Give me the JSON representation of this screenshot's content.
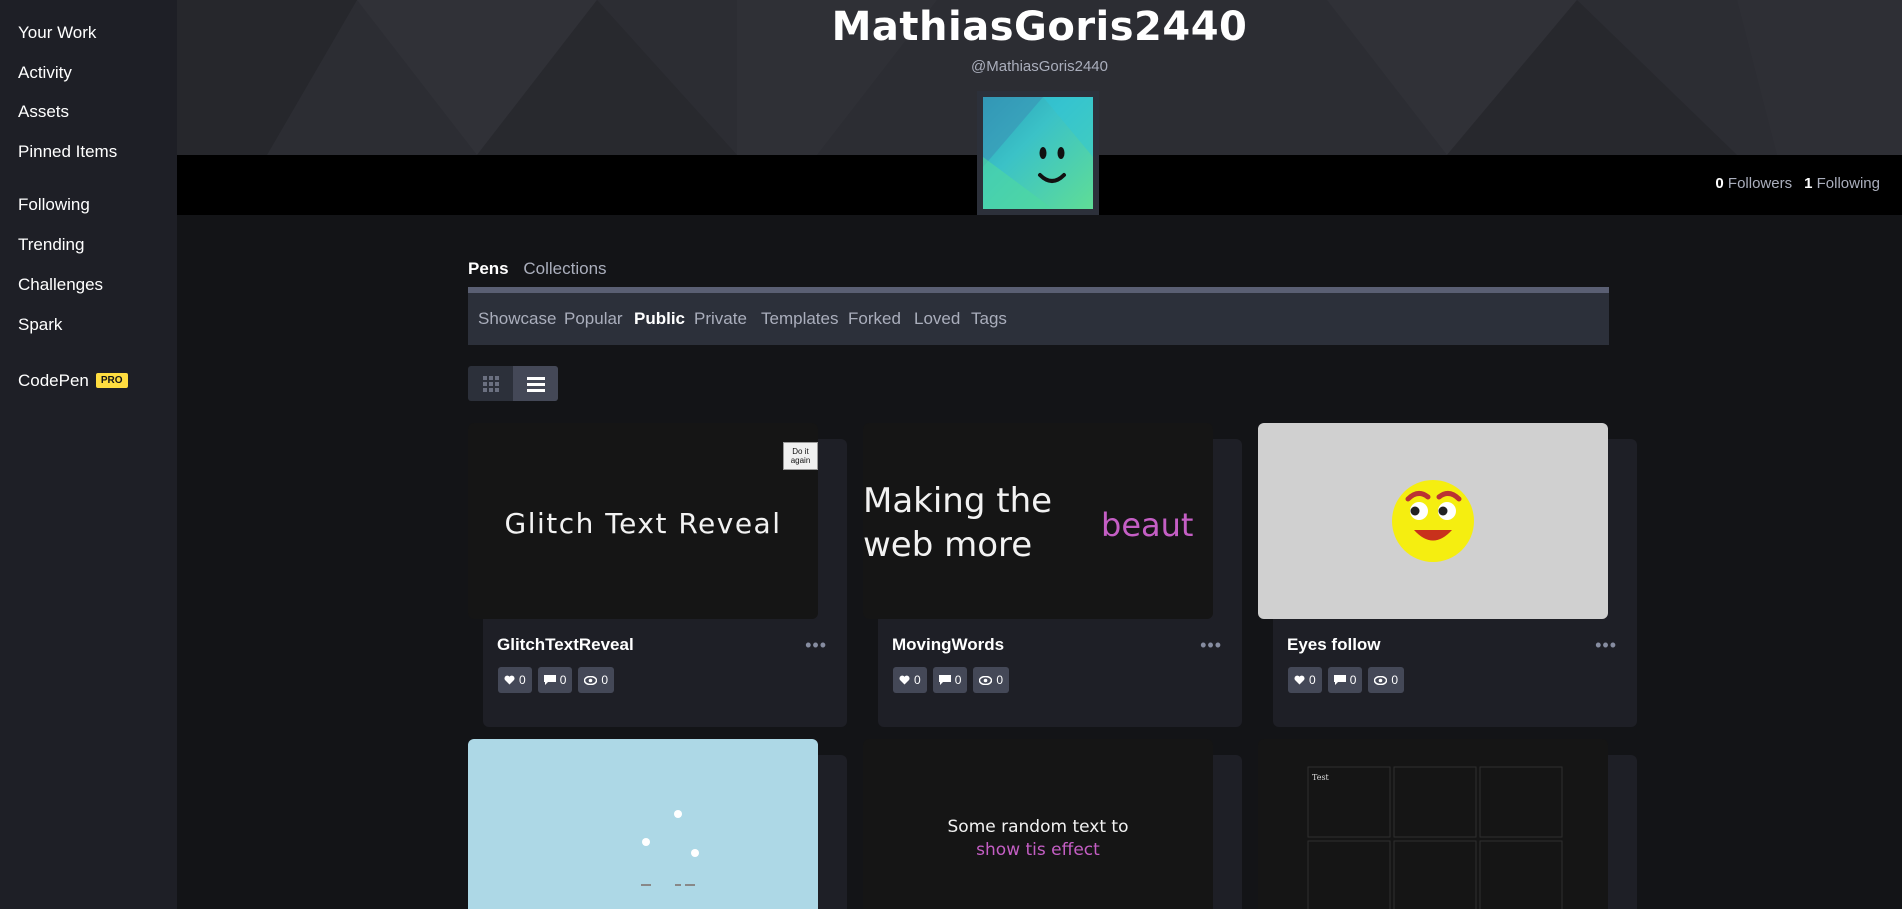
{
  "sidebar": {
    "items": [
      {
        "label": "Your Work"
      },
      {
        "label": "Activity"
      },
      {
        "label": "Assets"
      },
      {
        "label": "Pinned Items"
      },
      {
        "label": "Following"
      },
      {
        "label": "Trending"
      },
      {
        "label": "Challenges"
      },
      {
        "label": "Spark"
      },
      {
        "label": "CodePen"
      }
    ],
    "pro_badge": "PRO"
  },
  "profile": {
    "name": "MathiasGoris2440",
    "handle": "@MathiasGoris2440",
    "followers_count": "0",
    "followers_label": "Followers",
    "following_count": "1",
    "following_label": "Following"
  },
  "tabs": {
    "pens": "Pens",
    "collections": "Collections"
  },
  "filters": [
    "Showcase",
    "Popular",
    "Public",
    "Private",
    "Templates",
    "Forked",
    "Loved",
    "Tags"
  ],
  "active_filter": "Public",
  "cards": [
    {
      "title": "GlitchTextReveal",
      "preview_text": "Glitch Text Reveal",
      "button": "Do it again",
      "likes": "0",
      "comments": "0",
      "views": "0"
    },
    {
      "title": "MovingWords",
      "preview_line1": "Making the",
      "preview_line2": "web more",
      "preview_word": "beaut",
      "likes": "0",
      "comments": "0",
      "views": "0"
    },
    {
      "title": "Eyes follow",
      "likes": "0",
      "comments": "0",
      "views": "0"
    }
  ],
  "bottom_cards": [
    {},
    {
      "preview_line1": "Some random text to",
      "preview_line2": "show tis effect"
    },
    {
      "preview_label": "Test"
    }
  ],
  "colors": {
    "background": "#131417",
    "sidebar": "#1e1f26",
    "card": "#1e1f26",
    "badge": "#444857",
    "pro": "#ffdd40",
    "accent_purple": "#c45ec4"
  }
}
